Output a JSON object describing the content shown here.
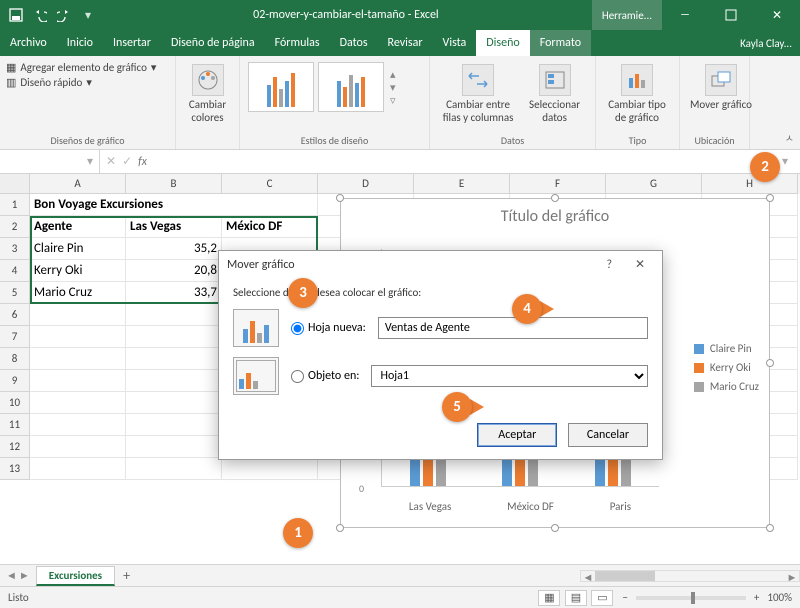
{
  "titlebar": {
    "filename": "02-mover-y-cambiar-el-tamaño - Excel",
    "tools_context": "Herramie..."
  },
  "tabs": {
    "archivo": "Archivo",
    "inicio": "Inicio",
    "insertar": "Insertar",
    "diseno_pagina": "Diseño de página",
    "formulas": "Fórmulas",
    "datos": "Datos",
    "revisar": "Revisar",
    "vista": "Vista",
    "diseno": "Diseño",
    "formato": "Formato",
    "account": "Kayla Clay..."
  },
  "ribbon": {
    "disenos_grafico_label": "Diseños de gráfico",
    "agregar_elemento": "Agregar elemento de gráfico",
    "diseno_rapido": "Diseño rápido",
    "cambiar_colores": "Cambiar colores",
    "estilos_diseno_label": "Estilos de diseño",
    "datos_label": "Datos",
    "cambiar_filas_cols": "Cambiar entre filas y columnas",
    "seleccionar_datos": "Seleccionar datos",
    "tipo_label": "Tipo",
    "cambiar_tipo": "Cambiar tipo de gráfico",
    "ubicacion_label": "Ubicación",
    "mover_grafico": "Mover gráfico"
  },
  "formula_bar": {
    "namebox": "",
    "fx": "fx"
  },
  "columns": [
    "A",
    "B",
    "C",
    "D",
    "E",
    "F",
    "G",
    "H"
  ],
  "rownums": [
    "1",
    "2",
    "3",
    "4",
    "5",
    "6",
    "7",
    "8",
    "9",
    "10",
    "11",
    "12",
    "13"
  ],
  "grid": {
    "title": "Bon Voyage Excursiones",
    "hdr_agente": "Agente",
    "hdr_vegas": "Las Vegas",
    "hdr_mexico": "México DF",
    "r3a": "Claire Pin",
    "r3b": "35,2",
    "r4a": "Kerry Oki",
    "r4b": "20,8",
    "r5a": "Mario Cruz",
    "r5b": "33,7"
  },
  "chart": {
    "title": "Título del gráfico",
    "y_zero": "0",
    "categories": [
      "Las Vegas",
      "México DF",
      "Paris"
    ],
    "legend": [
      {
        "name": "Claire Pin",
        "color": "#5b9bd5"
      },
      {
        "name": "Kerry Oki",
        "color": "#ed7d31"
      },
      {
        "name": "Mario Cruz",
        "color": "#a5a5a5"
      }
    ]
  },
  "dialog": {
    "title": "Mover gráfico",
    "help": "?",
    "close": "✕",
    "prompt": "Seleccione dónde desea colocar el gráfico:",
    "opt_new": "Hoja nueva:",
    "opt_new_value": "Ventas de Agente",
    "opt_obj": "Objeto en:",
    "opt_obj_value": "Hoja1",
    "ok": "Aceptar",
    "cancel": "Cancelar"
  },
  "callouts": {
    "c1": "1",
    "c2": "2",
    "c3": "3",
    "c4": "4",
    "c5": "5"
  },
  "sheettab": {
    "name": "Excursiones",
    "add": "+"
  },
  "status": {
    "ready": "Listo",
    "zoom": "100%",
    "minus": "−",
    "plus": "+"
  }
}
